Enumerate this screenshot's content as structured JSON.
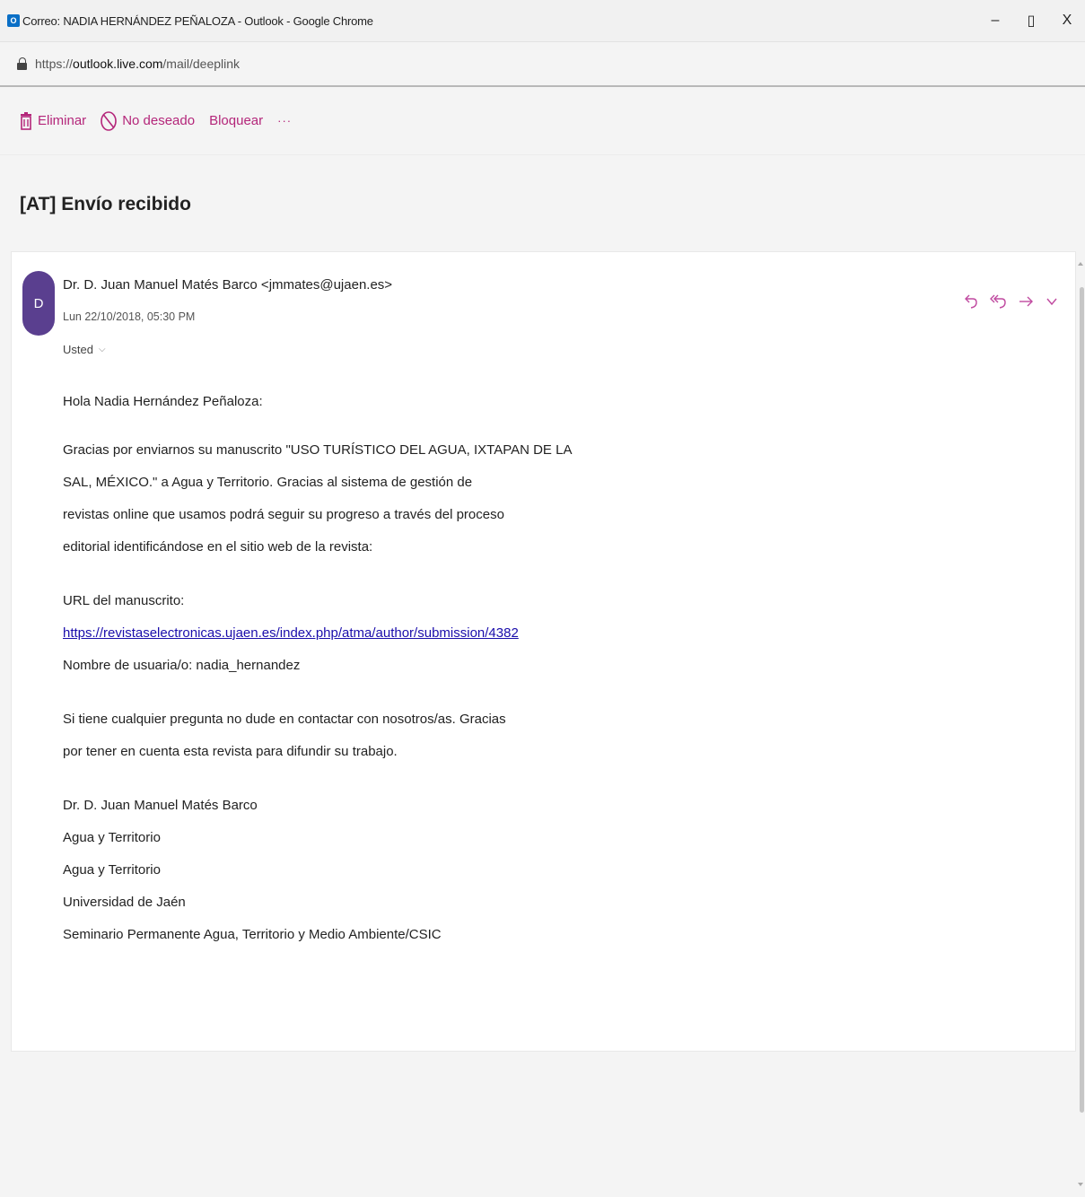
{
  "window": {
    "app_icon_label": "O",
    "title": "Correo: NADIA HERNÁNDEZ PEÑALOZA - Outlook - Google Chrome",
    "minimize": "–",
    "restore": "▯",
    "close": "X"
  },
  "address": {
    "scheme": "https://",
    "domain": "outlook.live.com",
    "path": "/mail/deeplink"
  },
  "commands": {
    "delete": "Eliminar",
    "junk": "No deseado",
    "block": "Bloquear",
    "more": "···"
  },
  "message": {
    "subject": "[AT] Envío recibido",
    "avatar_initial": "D",
    "from": "Dr. D. Juan Manuel Matés Barco <jmmates@ujaen.es>",
    "date": "Lun 22/10/2018, 05:30 PM",
    "to": "Usted",
    "greeting": "Hola Nadia Hernández Peñaloza:",
    "para1": [
      "Gracias por enviarnos su manuscrito \"USO TURÍSTICO DEL AGUA, IXTAPAN DE LA",
      "SAL, MÉXICO.\" a Agua y Territorio. Gracias al sistema de gestión de",
      "revistas online que usamos podrá seguir su progreso a través del proceso",
      "editorial identificándose en el sitio web de la revista:"
    ],
    "url_label": "URL del manuscrito:",
    "url": "https://revistaselectronicas.ujaen.es/index.php/atma/author/submission/4382",
    "username_line": "Nombre de usuaria/o: nadia_hernandez",
    "para2": [
      "Si tiene cualquier pregunta no dude en contactar con nosotros/as. Gracias",
      "por tener en cuenta esta revista para difundir su trabajo."
    ],
    "signature": [
      "Dr. D. Juan Manuel Matés Barco",
      "Agua y Territorio",
      "Agua y Territorio",
      "Universidad de Jaén",
      "Seminario Permanente Agua, Territorio y Medio Ambiente/CSIC"
    ]
  },
  "colors": {
    "accent": "#b4267a",
    "action_icons": "#c04aa0",
    "avatar": "#5a3f8f",
    "link": "#1a0dab"
  }
}
